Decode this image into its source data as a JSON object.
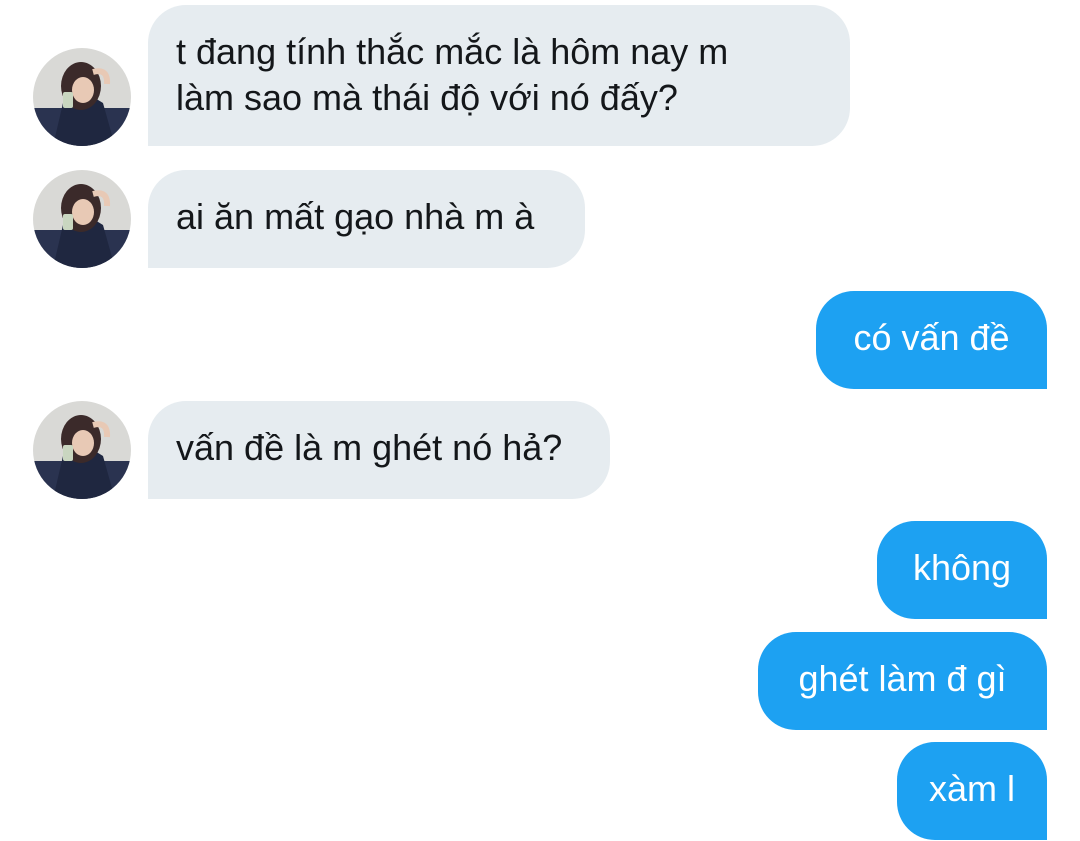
{
  "conversation": {
    "messages": [
      {
        "sender": "other",
        "text": "t đang tính thắc mắc là hôm nay m\nlàm sao mà thái độ với nó đấy?"
      },
      {
        "sender": "other",
        "text": "ai ăn mất gạo nhà m à"
      },
      {
        "sender": "me",
        "text": "có vấn đề"
      },
      {
        "sender": "other",
        "text": "vấn đề là m ghét nó hả?"
      },
      {
        "sender": "me",
        "text": "không"
      },
      {
        "sender": "me",
        "text": "ghét làm đ gì"
      },
      {
        "sender": "me",
        "text": "xàm l"
      }
    ]
  },
  "colors": {
    "incoming_bubble": "#e6ecf0",
    "outgoing_bubble": "#1da1f2",
    "incoming_text": "#14171a",
    "outgoing_text": "#ffffff"
  },
  "icons": {
    "avatar": "user-avatar-photo"
  }
}
